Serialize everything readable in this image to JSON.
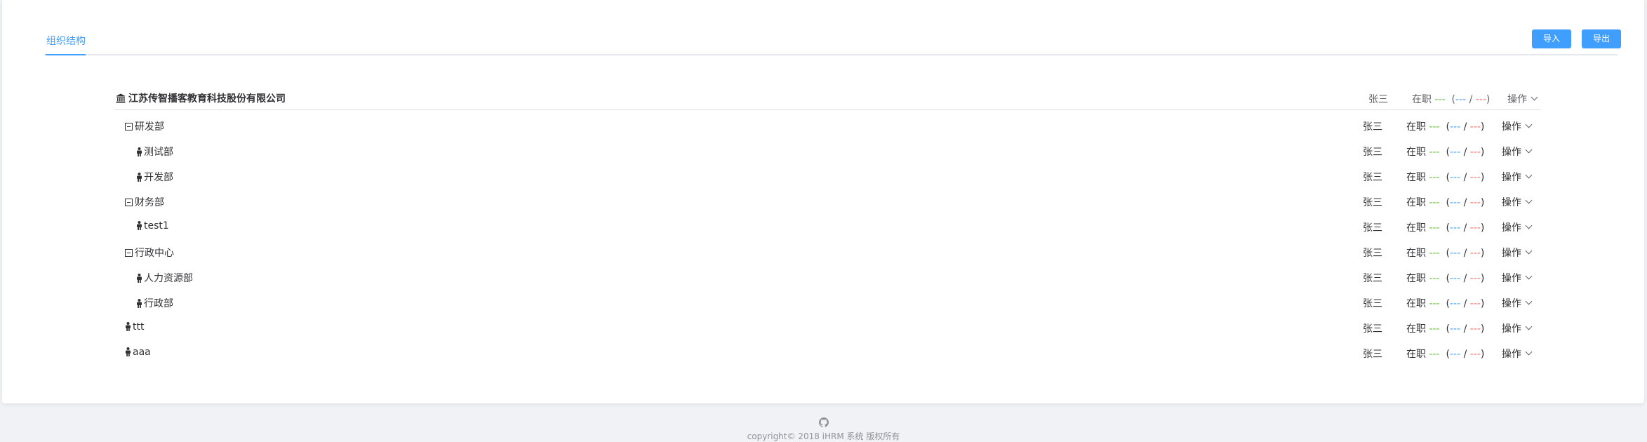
{
  "tabs": [
    {
      "label": "组织结构"
    }
  ],
  "toolbar": {
    "import_label": "导入",
    "export_label": "导出"
  },
  "company": {
    "name": "江苏传智播客教育科技股份有限公司",
    "manager": "张三",
    "status": "在职",
    "count": "---",
    "count_a": "---",
    "count_b": "---",
    "op_label": "操作"
  },
  "departments": [
    {
      "name": "研发部",
      "level": 1,
      "expandable": true,
      "manager": "张三",
      "status": "在职",
      "count": "---",
      "count_a": "---",
      "count_b": "---",
      "op_label": "操作"
    },
    {
      "name": "测试部",
      "level": 2,
      "expandable": false,
      "manager": "张三",
      "status": "在职",
      "count": "---",
      "count_a": "---",
      "count_b": "---",
      "op_label": "操作"
    },
    {
      "name": "开发部",
      "level": 2,
      "expandable": false,
      "manager": "张三",
      "status": "在职",
      "count": "---",
      "count_a": "---",
      "count_b": "---",
      "op_label": "操作"
    },
    {
      "name": "财务部",
      "level": 1,
      "expandable": true,
      "manager": "张三",
      "status": "在职",
      "count": "---",
      "count_a": "---",
      "count_b": "---",
      "op_label": "操作"
    },
    {
      "name": "test1",
      "level": 2,
      "expandable": false,
      "manager": "张三",
      "status": "在职",
      "count": "---",
      "count_a": "---",
      "count_b": "---",
      "op_label": "操作"
    },
    {
      "name": "行政中心",
      "level": 1,
      "expandable": true,
      "manager": "张三",
      "status": "在职",
      "count": "---",
      "count_a": "---",
      "count_b": "---",
      "op_label": "操作"
    },
    {
      "name": "人力资源部",
      "level": 2,
      "expandable": false,
      "manager": "张三",
      "status": "在职",
      "count": "---",
      "count_a": "---",
      "count_b": "---",
      "op_label": "操作"
    },
    {
      "name": "行政部",
      "level": 2,
      "expandable": false,
      "manager": "张三",
      "status": "在职",
      "count": "---",
      "count_a": "---",
      "count_b": "---",
      "op_label": "操作"
    },
    {
      "name": "ttt",
      "level": 1,
      "expandable": false,
      "manager": "张三",
      "status": "在职",
      "count": "---",
      "count_a": "---",
      "count_b": "---",
      "op_label": "操作"
    },
    {
      "name": "aaa",
      "level": 1,
      "expandable": false,
      "manager": "张三",
      "status": "在职",
      "count": "---",
      "count_a": "---",
      "count_b": "---",
      "op_label": "操作"
    }
  ],
  "footer": {
    "copyright": "copyright© 2018 iHRM 系统 版权所有",
    "icon": "github-icon"
  },
  "colors": {
    "accent": "#409eff",
    "green": "#67c23a",
    "red": "#f56c6c"
  }
}
